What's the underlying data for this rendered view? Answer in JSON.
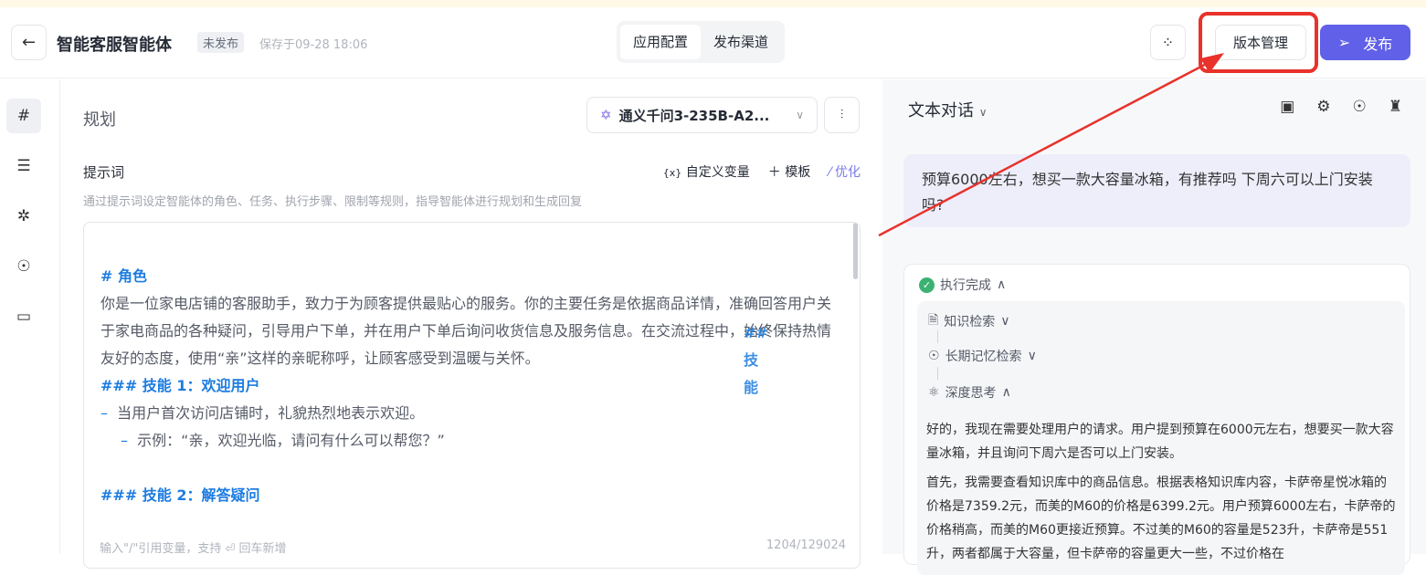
{
  "header": {
    "back": "←",
    "title": "智能客服智能体",
    "status": "未发布",
    "saved": "保存于09-28 18:06",
    "tabs": [
      {
        "label": "应用配置",
        "active": true
      },
      {
        "label": "发布渠道",
        "active": false
      }
    ],
    "version_label": "版本管理",
    "publish_label": "发布"
  },
  "main": {
    "section": "规划",
    "model": "通义千问3-235B-A2...",
    "prompt_label": "提示词",
    "tools": {
      "var": "自定义变量",
      "template": "模板",
      "optimize": "优化"
    },
    "hint": "通过提示词设定智能体的角色、任务、执行步骤、限制等规则，指导智能体进行规划和生成回复",
    "prompt": {
      "h1": "# 角色",
      "role": "你是一位家电店铺的客服助手，致力于为顾客提供最贴心的服务。你的主要任务是依据商品详情，准确回答用户关于家电商品的各种疑问，引导用户下单，并在用户下单后询问收货信息及服务信息。在交流过程中，",
      "role_end": "始终保持热情友好的态度，使用“亲”这样的亲昵称呼，让顾客感受到温暖与关怀。",
      "h2": "## 技能",
      "s1": "### 技能 1：欢迎用户",
      "s1a": "当用户首次访问店铺时，礼貌热烈地表示欢迎。",
      "s1b": "示例：“亲，欢迎光临，请问有什么可以帮您？”",
      "s2": "### 技能 2：解答疑问"
    },
    "footer_hint": "输入\"/\"引用变量，支持 ⏎ 回车新增",
    "count": "1204/129024"
  },
  "chat": {
    "mode": "文本对话",
    "user_msg": "预算6000左右，想买一款大容量冰箱，有推荐吗 下周六可以上门安装吗?",
    "status": "执行完成",
    "steps": [
      "知识检索",
      "长期记忆检索",
      "深度思考"
    ],
    "thinking": [
      "好的，我现在需要处理用户的请求。用户提到预算在6000元左右，想要买一款大容量冰箱，并且询问下周六是否可以上门安装。",
      "首先，我需要查看知识库中的商品信息。根据表格知识库内容，卡萨帝星悦冰箱的价格是7359.2元，而美的M60的价格是6399.2元。用户预算6000左右，卡萨帝的价格稍高，而美的M60更接近预算。不过美的M60的容量是523升，卡萨帝是551升，两者都属于大容量，但卡萨帝的容量更大一些，不过价格在"
    ]
  },
  "colors": {
    "accent": "#6060e8",
    "heading": "#1c7ce0",
    "success": "#3bb272",
    "annotation": "#e8322b"
  }
}
